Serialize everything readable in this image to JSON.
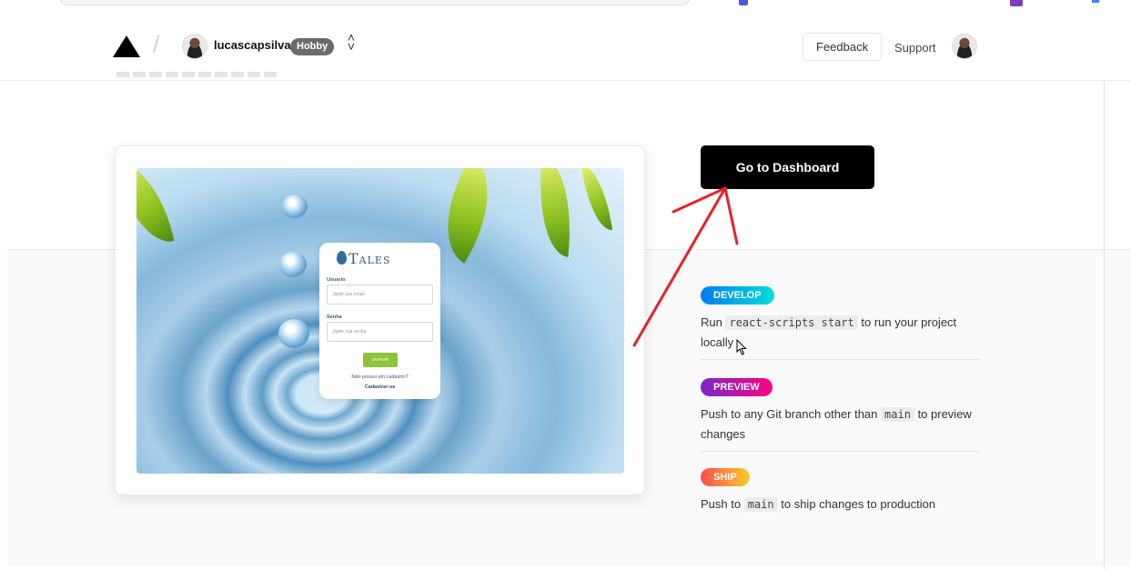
{
  "header": {
    "username": "lucascapsilva",
    "plan_badge": "Hobby",
    "feedback_label": "Feedback",
    "support_label": "Support"
  },
  "preview": {
    "login": {
      "brand": "Tales",
      "user_label": "Usuario",
      "user_placeholder": "digite seu email",
      "password_label": "Senha",
      "password_placeholder": "digite sua senha",
      "enter_label": "ENTRAR",
      "no_account": "Não possui um cadastro?",
      "register": "Cadastrar-se"
    }
  },
  "dashboard_button": "Go to Dashboard",
  "steps": [
    {
      "badge": "DEVELOP",
      "text_before": "Run",
      "code": "react-scripts start",
      "text_after": "to run your project locally"
    },
    {
      "badge": "PREVIEW",
      "text_before": "Push to any Git branch other than",
      "code": "main",
      "text_after": "to preview changes"
    },
    {
      "badge": "SHIP",
      "text_before": "Push to",
      "code": "main",
      "text_after": "to ship changes to production"
    }
  ],
  "colors": {
    "annotation": "#e8202a",
    "develop_gradient": [
      "#007cf0",
      "#00dfd8"
    ],
    "preview_gradient": [
      "#7928ca",
      "#ff0080"
    ],
    "ship_gradient": [
      "#ff4d4d",
      "#f9cb28"
    ]
  }
}
